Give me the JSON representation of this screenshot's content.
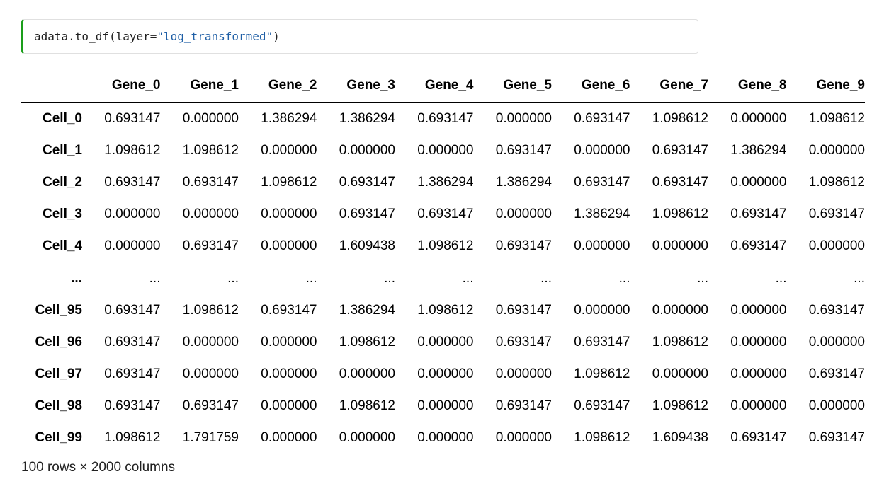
{
  "code": {
    "prefix": "adata.to_df(layer=",
    "string": "\"log_transformed\"",
    "suffix": ")"
  },
  "table": {
    "columns": [
      "Gene_0",
      "Gene_1",
      "Gene_2",
      "Gene_3",
      "Gene_4",
      "Gene_5",
      "Gene_6",
      "Gene_7",
      "Gene_8",
      "Gene_9"
    ],
    "rows": [
      {
        "index": "Cell_0",
        "values": [
          "0.693147",
          "0.000000",
          "1.386294",
          "1.386294",
          "0.693147",
          "0.000000",
          "0.693147",
          "1.098612",
          "0.000000",
          "1.098612"
        ]
      },
      {
        "index": "Cell_1",
        "values": [
          "1.098612",
          "1.098612",
          "0.000000",
          "0.000000",
          "0.000000",
          "0.693147",
          "0.000000",
          "0.693147",
          "1.386294",
          "0.000000"
        ]
      },
      {
        "index": "Cell_2",
        "values": [
          "0.693147",
          "0.693147",
          "1.098612",
          "0.693147",
          "1.386294",
          "1.386294",
          "0.693147",
          "0.693147",
          "0.000000",
          "1.098612"
        ]
      },
      {
        "index": "Cell_3",
        "values": [
          "0.000000",
          "0.000000",
          "0.000000",
          "0.693147",
          "0.693147",
          "0.000000",
          "1.386294",
          "1.098612",
          "0.693147",
          "0.693147"
        ]
      },
      {
        "index": "Cell_4",
        "values": [
          "0.000000",
          "0.693147",
          "0.000000",
          "1.609438",
          "1.098612",
          "0.693147",
          "0.000000",
          "0.000000",
          "0.693147",
          "0.000000"
        ]
      },
      {
        "index": "...",
        "values": [
          "...",
          "...",
          "...",
          "...",
          "...",
          "...",
          "...",
          "...",
          "...",
          "..."
        ]
      },
      {
        "index": "Cell_95",
        "values": [
          "0.693147",
          "1.098612",
          "0.693147",
          "1.386294",
          "1.098612",
          "0.693147",
          "0.000000",
          "0.000000",
          "0.000000",
          "0.693147"
        ]
      },
      {
        "index": "Cell_96",
        "values": [
          "0.693147",
          "0.000000",
          "0.000000",
          "1.098612",
          "0.000000",
          "0.693147",
          "0.693147",
          "1.098612",
          "0.000000",
          "0.000000"
        ]
      },
      {
        "index": "Cell_97",
        "values": [
          "0.693147",
          "0.000000",
          "0.000000",
          "0.000000",
          "0.000000",
          "0.000000",
          "1.098612",
          "0.000000",
          "0.000000",
          "0.693147"
        ]
      },
      {
        "index": "Cell_98",
        "values": [
          "0.693147",
          "0.693147",
          "0.000000",
          "1.098612",
          "0.000000",
          "0.693147",
          "0.693147",
          "1.098612",
          "0.000000",
          "0.000000"
        ]
      },
      {
        "index": "Cell_99",
        "values": [
          "1.098612",
          "1.791759",
          "0.000000",
          "0.000000",
          "0.000000",
          "0.000000",
          "1.098612",
          "1.609438",
          "0.693147",
          "0.693147"
        ]
      }
    ]
  },
  "footer": "100 rows × 2000 columns",
  "colors": {
    "cell_accent": "#1a9e1a",
    "string_literal": "#1f5fa6"
  }
}
